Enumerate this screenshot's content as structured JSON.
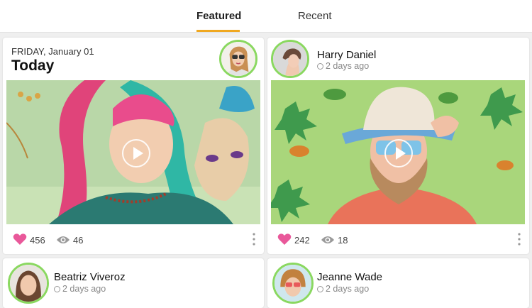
{
  "tabs": {
    "featured": "Featured",
    "recent": "Recent",
    "active": "featured"
  },
  "colors": {
    "accent": "#f0a820",
    "avatar_ring": "#8ad860",
    "heart": "#e9589a"
  },
  "cards": [
    {
      "date": "FRIDAY, January 01",
      "title": "Today",
      "likes": "456",
      "views": "46",
      "icons": [
        "heart-icon",
        "eye-icon",
        "more-icon",
        "play-icon"
      ]
    },
    {
      "name": "Harry Daniel",
      "time": "2 days ago",
      "likes": "242",
      "views": "18",
      "icons": [
        "heart-icon",
        "eye-icon",
        "more-icon",
        "play-icon",
        "clock-icon"
      ]
    },
    {
      "name": "Beatriz Viveroz",
      "time": "2 days ago"
    },
    {
      "name": "Jeanne Wade",
      "time": "2 days ago"
    }
  ]
}
